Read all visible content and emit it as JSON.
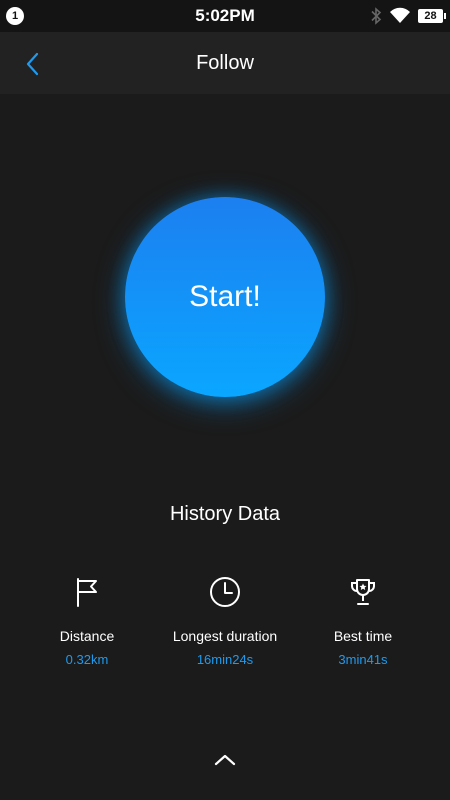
{
  "status_bar": {
    "notification_count": "1",
    "time": "5:02PM",
    "battery": "28",
    "icons": [
      "bluetooth-icon",
      "wifi-icon",
      "battery-icon"
    ]
  },
  "app_bar": {
    "back_icon": "chevron-left-icon",
    "title": "Follow"
  },
  "start_button": {
    "label": "Start!"
  },
  "history": {
    "title": "History Data",
    "stats": [
      {
        "icon": "flag-icon",
        "label": "Distance",
        "value": "0.32km"
      },
      {
        "icon": "clock-icon",
        "label": "Longest duration",
        "value": "16min24s"
      },
      {
        "icon": "trophy-icon",
        "label": "Best time",
        "value": "3min41s"
      }
    ]
  },
  "footer": {
    "expand_icon": "chevron-up-icon"
  },
  "colors": {
    "background": "#1b1b1b",
    "app_bar": "#222222",
    "accent": "#1e9bf0",
    "start_gradient_top": "#1c7ff0",
    "start_gradient_bottom": "#0aa6ff"
  }
}
